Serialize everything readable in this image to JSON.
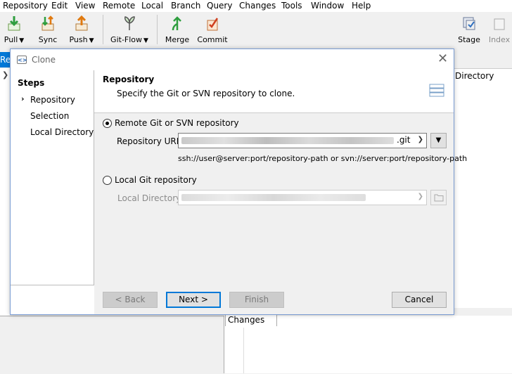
{
  "menu": [
    "Repository",
    "Edit",
    "View",
    "Remote",
    "Local",
    "Branch",
    "Query",
    "Changes",
    "Tools",
    "Window",
    "Help"
  ],
  "toolbar": {
    "pull": "Pull",
    "sync": "Sync",
    "push": "Push",
    "gitflow": "Git-Flow",
    "merge": "Merge",
    "commit": "Commit",
    "stage": "Stage",
    "index": "Index"
  },
  "background": {
    "tab_label": "Re",
    "right_label": "Directory",
    "changes_tab": "Changes"
  },
  "dialog": {
    "title": "Clone",
    "steps_header": "Steps",
    "steps": [
      "Repository",
      "Selection",
      "Local Directory"
    ],
    "section_title": "Repository",
    "section_desc": "Specify the Git or SVN repository to clone.",
    "remote_option": "Remote Git or SVN repository",
    "repo_url_label": "Repository URL:",
    "repo_url_suffix": ".git",
    "hint": "ssh://user@server:port/repository-path or svn://server:port/repository-path",
    "local_option": "Local Git repository",
    "local_dir_label": "Local Directory:",
    "buttons": {
      "back": "< Back",
      "next": "Next >",
      "finish": "Finish",
      "cancel": "Cancel"
    }
  }
}
